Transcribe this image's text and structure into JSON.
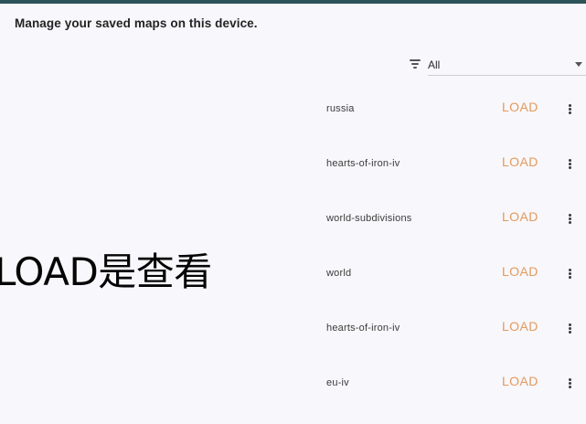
{
  "header": {
    "title": "Manage your saved maps on this device."
  },
  "filter": {
    "icon": "filter-icon",
    "selected": "All"
  },
  "maps": [
    {
      "name": "russia",
      "action": "LOAD"
    },
    {
      "name": "hearts-of-iron-iv",
      "action": "LOAD"
    },
    {
      "name": "world-subdivisions",
      "action": "LOAD"
    },
    {
      "name": "world",
      "action": "LOAD"
    },
    {
      "name": "hearts-of-iron-iv",
      "action": "LOAD"
    },
    {
      "name": "eu-iv",
      "action": "LOAD"
    }
  ],
  "overlay": {
    "caption": "LOAD是查看"
  },
  "colors": {
    "accent": "#e39a5d",
    "top_bar": "#2b5358",
    "background": "#f8f7fb"
  }
}
